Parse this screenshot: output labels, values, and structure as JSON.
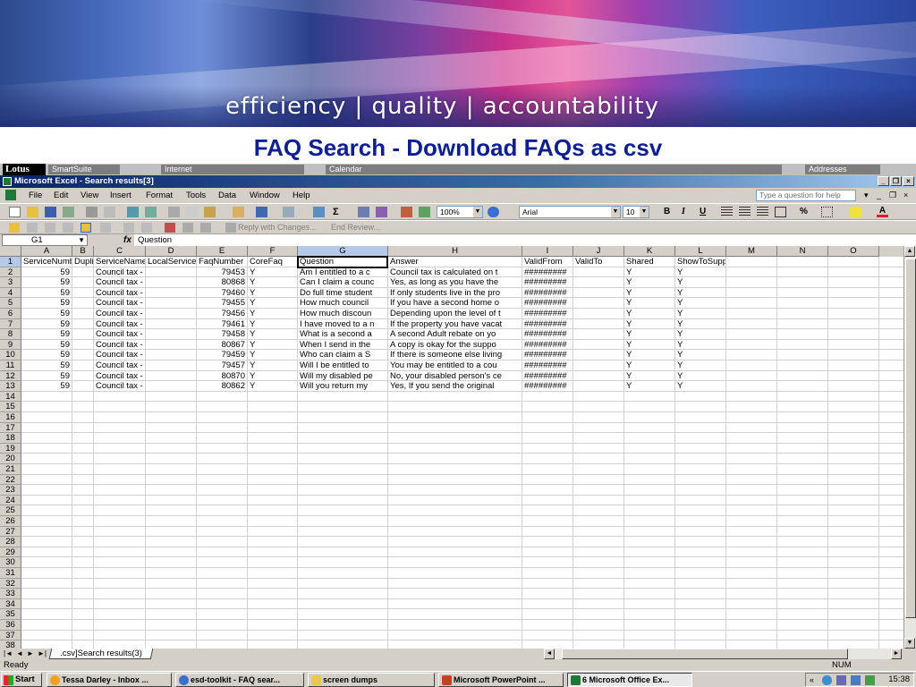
{
  "banner": {
    "tagline": "efficiency | quality | accountability"
  },
  "slide": {
    "title": "FAQ Search - Download FAQs as csv"
  },
  "lotus": {
    "logo": "Lotus",
    "buttons": [
      "SmartSuite",
      "Internet",
      "Calendar",
      "Addresses"
    ]
  },
  "window": {
    "title": "Microsoft Excel - Search results[3]"
  },
  "menu": {
    "items": [
      "File",
      "Edit",
      "View",
      "Insert",
      "Format",
      "Tools",
      "Data",
      "Window",
      "Help"
    ],
    "help_placeholder": "Type a question for help"
  },
  "toolbar": {
    "zoom": "100%",
    "font": "Arial",
    "font_size": "10",
    "bold": "B",
    "italic": "I",
    "underline": "U",
    "percent": "%",
    "reply_changes": "Reply with Changes...",
    "end_review": "End Review..."
  },
  "formula_bar": {
    "name_box": "G1",
    "fx": "fx",
    "content": "Question"
  },
  "sheet": {
    "columns": [
      "A",
      "B",
      "C",
      "D",
      "E",
      "F",
      "G",
      "H",
      "I",
      "J",
      "K",
      "L",
      "M",
      "N",
      "O"
    ],
    "selected_column": "G",
    "row_numbers": [
      "1",
      "2",
      "3",
      "4",
      "5",
      "6",
      "7",
      "8",
      "9",
      "10",
      "11",
      "12",
      "13",
      "14",
      "15",
      "16",
      "17",
      "18",
      "19",
      "20",
      "21",
      "22",
      "23",
      "24",
      "25",
      "26",
      "27",
      "28",
      "29",
      "30",
      "31",
      "32",
      "33",
      "34",
      "35",
      "36",
      "37",
      "38"
    ],
    "header_row": [
      "ServiceNumber",
      "Duplicate",
      "ServiceName",
      "LocalService",
      "FaqNumber",
      "CoreFaq",
      "Question",
      "Answer",
      "ValidFrom",
      "ValidTo",
      "Shared",
      "ShowToSuppliers",
      "",
      "",
      ""
    ],
    "rows": [
      [
        "59",
        "",
        "Council tax - discounts",
        "",
        "79453",
        "Y",
        "Am I entitled to a c",
        "Council tax is calculated on t",
        "#########",
        "",
        "Y",
        "Y"
      ],
      [
        "59",
        "",
        "Council tax - discounts",
        "",
        "80868",
        "Y",
        "Can I claim a counc",
        "Yes, as long as you have the",
        "#########",
        "",
        "Y",
        "Y"
      ],
      [
        "59",
        "",
        "Council tax - discounts",
        "",
        "79460",
        "Y",
        "Do full time student",
        "If only students live in the pro",
        "#########",
        "",
        "Y",
        "Y"
      ],
      [
        "59",
        "",
        "Council tax - discounts",
        "",
        "79455",
        "Y",
        "How much council",
        "If you have a second home o",
        "#########",
        "",
        "Y",
        "Y"
      ],
      [
        "59",
        "",
        "Council tax - discounts",
        "",
        "79456",
        "Y",
        "How much discoun",
        "Depending upon the level of t",
        "#########",
        "",
        "Y",
        "Y"
      ],
      [
        "59",
        "",
        "Council tax - discounts",
        "",
        "79461",
        "Y",
        "I have moved to a n",
        "If the property you have vacat",
        "#########",
        "",
        "Y",
        "Y"
      ],
      [
        "59",
        "",
        "Council tax - discounts",
        "",
        "79458",
        "Y",
        "What is a second a",
        "A second Adult rebate on yo",
        "#########",
        "",
        "Y",
        "Y"
      ],
      [
        "59",
        "",
        "Council tax - discounts",
        "",
        "80867",
        "Y",
        "When I send in the",
        "A copy is okay for the suppo",
        "#########",
        "",
        "Y",
        "Y"
      ],
      [
        "59",
        "",
        "Council tax - discounts",
        "",
        "79459",
        "Y",
        "Who can claim a S",
        "If there is someone else living",
        "#########",
        "",
        "Y",
        "Y"
      ],
      [
        "59",
        "",
        "Council tax - discounts",
        "",
        "79457",
        "Y",
        "Will I be entitled to",
        "You may be entitled to a cou",
        "#########",
        "",
        "Y",
        "Y"
      ],
      [
        "59",
        "",
        "Council tax - discounts",
        "",
        "80870",
        "Y",
        "Will my disabled pe",
        "No, your disabled person's ce",
        "#########",
        "",
        "Y",
        "Y"
      ],
      [
        "59",
        "",
        "Council tax - discounts",
        "",
        "80862",
        "Y",
        "Will you return my",
        "Yes, If you send the original",
        "#########",
        "",
        "Y",
        "Y"
      ]
    ]
  },
  "sheet_tabs": {
    "active": ".csv]Search results(3)"
  },
  "status": {
    "left": "Ready",
    "num": "NUM"
  },
  "taskbar": {
    "start": "Start",
    "items": [
      "Tessa Darley - Inbox ...",
      "esd-toolkit - FAQ sear...",
      "screen dumps",
      "Microsoft PowerPoint ...",
      "6 Microsoft Office Ex..."
    ],
    "time": "15:38"
  }
}
